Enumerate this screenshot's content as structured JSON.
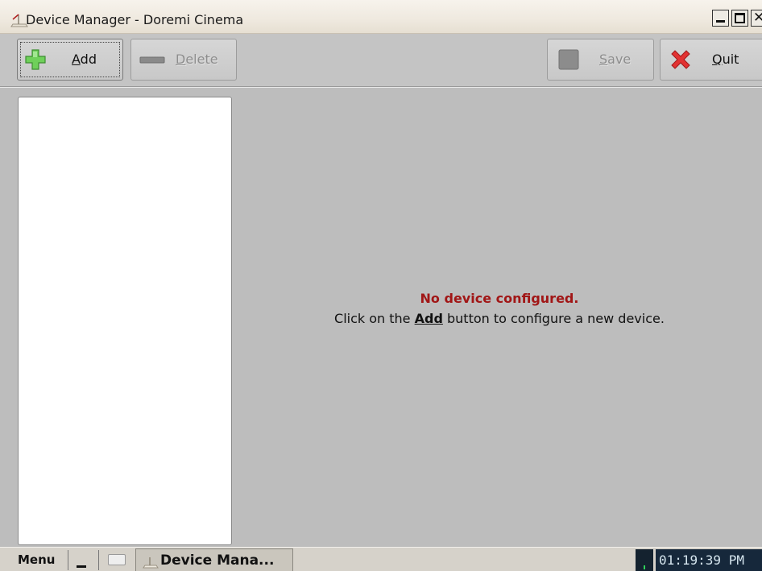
{
  "window": {
    "title": "Device Manager - Doremi Cinema",
    "icon": "desk-lamp-icon"
  },
  "toolbar": {
    "add": {
      "prefix": "",
      "underline": "A",
      "rest": "dd",
      "icon": "plus-icon",
      "icon_color": "#5bc24a"
    },
    "delete": {
      "prefix": "",
      "underline": "D",
      "rest": "elete",
      "icon": "minus-icon"
    },
    "save": {
      "prefix": "",
      "underline": "S",
      "rest": "ave",
      "icon": "save-icon"
    },
    "quit": {
      "prefix": "",
      "underline": "Q",
      "rest": "uit",
      "icon": "close-x-icon",
      "icon_color": "#e02a2a"
    }
  },
  "main": {
    "device_list": [],
    "message": {
      "title": "No device configured.",
      "body_before": "Click on the ",
      "body_bold": "Add",
      "body_after": " button to configure a new device."
    }
  },
  "taskbar": {
    "menu_label": "Menu",
    "task_label": "Device Mana...",
    "clock": "01:19:39 PM"
  },
  "colors": {
    "message_title": "#a11616",
    "background": "#bdbdbd",
    "clock_bg": "#16283b"
  }
}
